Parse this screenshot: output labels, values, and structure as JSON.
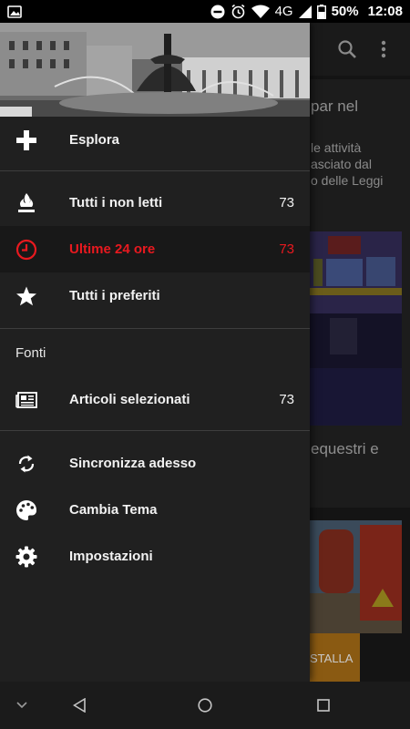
{
  "status_bar": {
    "network": "4G",
    "battery": "50%",
    "time": "12:08",
    "icons": [
      "gallery-icon",
      "dnd-icon",
      "alarm-icon",
      "wifi-icon",
      "signal-icon",
      "battery-icon"
    ]
  },
  "background_app": {
    "toolbar_icons": [
      "search-icon",
      "overflow-menu-icon"
    ],
    "article1_title": "par nel",
    "article1_lines": [
      "le attività",
      "asciato dal",
      "o delle Leggi"
    ],
    "article2_title": "equestri e",
    "install_button": "STALLA"
  },
  "drawer": {
    "header_image": "fountain-photo",
    "items": [
      {
        "label": "Esplora",
        "count": "",
        "icon": "plus-icon"
      },
      {
        "label": "Tutti i non letti",
        "count": "73",
        "icon": "flame-icon"
      },
      {
        "label": "Ultime 24 ore",
        "count": "73",
        "icon": "clock-icon",
        "active": true
      },
      {
        "label": "Tutti i preferiti",
        "count": "",
        "icon": "star-icon"
      }
    ],
    "sources_title": "Fonti",
    "sources": [
      {
        "label": "Articoli selezionati",
        "count": "73",
        "icon": "newspaper-icon"
      }
    ],
    "actions": [
      {
        "label": "Sincronizza adesso",
        "icon": "sync-icon"
      },
      {
        "label": "Cambia Tema",
        "icon": "palette-icon"
      },
      {
        "label": "Impostazioni",
        "icon": "settings-icon"
      }
    ]
  },
  "colors": {
    "accent_active": "#e8191f",
    "drawer_bg": "#202020",
    "install_button": "#8a5a12"
  },
  "nav_bar": {
    "buttons": [
      "collapse-chevron-icon",
      "back-icon",
      "home-icon",
      "recents-icon"
    ]
  }
}
